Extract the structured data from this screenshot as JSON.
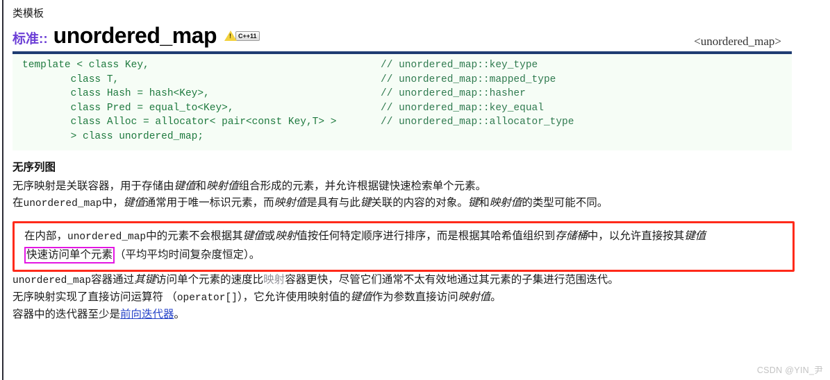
{
  "header": {
    "kicker": "类模板",
    "std_prefix": "标准::",
    "title": "unordered_map",
    "badge_label": "C++11",
    "warning_icon": "warning-triangle-icon",
    "include_header": "<unordered_map>"
  },
  "code": {
    "lines": [
      {
        "code": "template < class Key,",
        "comment": "// unordered_map::key_type"
      },
      {
        "code": "        class T,",
        "comment": "// unordered_map::mapped_type"
      },
      {
        "code": "        class Hash = hash<Key>,",
        "comment": "// unordered_map::hasher"
      },
      {
        "code": "        class Pred = equal_to<Key>,",
        "comment": "// unordered_map::key_equal"
      },
      {
        "code": "        class Alloc = allocator< pair<const Key,T> >",
        "comment": "// unordered_map::allocator_type"
      },
      {
        "code": "        > class unordered_map;",
        "comment": ""
      }
    ]
  },
  "section": {
    "heading": "无序列图",
    "p1": {
      "t1": "无序映射是关联容器，用于存储由",
      "i1": "键值",
      "t2": "和",
      "i2": "映射值",
      "t3": "组合形成的元素，并允许根据键快速检索单个元素。"
    },
    "p2": {
      "t1": "在",
      "m1": "unordered_map",
      "t2": "中，",
      "i1": "键值",
      "t3": "通常用于唯一标识元素，而",
      "i2": "映射值",
      "t4": "是具有与此",
      "i3": "键",
      "t5": "关联的内容的对象。",
      "i4": "键",
      "t6": "和",
      "i5": "映射值",
      "t7": "的类型可能不同。"
    },
    "boxed": {
      "t1": "在内部，",
      "m1": "unordered_map",
      "t2": "中的元素不会根据其",
      "i1": "键值",
      "t3": "或",
      "i2": "映射",
      "t4": "值按任何特定顺序进行排序，而是根据其哈希值组织到",
      "i3": "存储桶",
      "t5": "中，以允许直接按其",
      "i4": "键值",
      "highlight": "快速访问单个元素",
      "t6": "（平均平均时间复杂度恒定）。"
    },
    "p3": {
      "m1": "unordered_map",
      "t1": "容器通过",
      "i1": "其键",
      "t2": "访问单个元素的速度比",
      "f1": "映射",
      "t3": "容器更快，尽管它们通常不太有效地通过其元素的子集进行范围迭代。"
    },
    "p4": {
      "t1": "无序映射实现了直接访问运算符 （",
      "m1": "operator[]",
      "t2": "），它允许使用映射值的",
      "i1": "键值",
      "t3": "作为参数直接访问",
      "i2": "映射值",
      "t4": "。"
    },
    "p5": {
      "t1": "容器中的迭代器至少是",
      "link": "前向迭代器",
      "t2": "。"
    }
  },
  "watermark": "CSDN @YIN_尹",
  "colors": {
    "accent_purple": "#6c3fd6",
    "code_green": "#1f7a3f",
    "code_top_border": "#1f3c72",
    "annotation_red": "#ff2a1a",
    "annotation_magenta": "#e316e3",
    "link_blue": "#2442c8"
  }
}
